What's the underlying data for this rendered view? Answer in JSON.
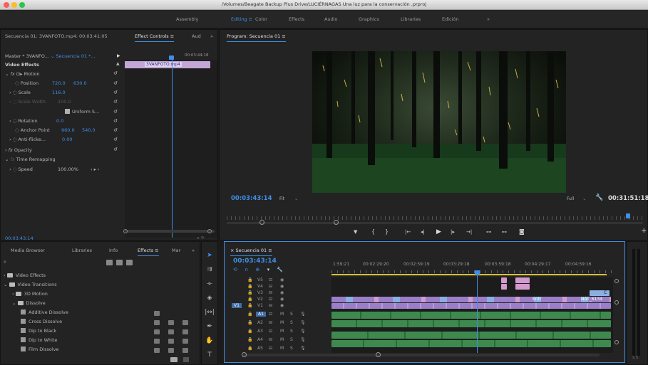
{
  "window": {
    "title": "/Volumes/Beagate Backup Plus Drive/LUCIÉRNAGAS Una luz para la conservación .prproj"
  },
  "workspaces": [
    {
      "label": "Assembly",
      "active": false
    },
    {
      "label": "Editing",
      "active": true
    },
    {
      "label": "Color",
      "active": false
    },
    {
      "label": "Effects",
      "active": false
    },
    {
      "label": "Audio",
      "active": false
    },
    {
      "label": "Graphics",
      "active": false
    },
    {
      "label": "Libraries",
      "active": false
    },
    {
      "label": "Edición",
      "active": false
    },
    {
      "label": "»",
      "active": false
    }
  ],
  "left_panel": {
    "tabs": [
      "Secuencia 01: 3VANFOTO.mp4: 00:03:41:05",
      "Effect Controls",
      "Aud",
      "»"
    ],
    "master_label": "Master * 3VANFO...",
    "sequence_label": "Secuencia 01 *...",
    "header_timecode": "00:03:44:18",
    "clip_name": "3VANFOTO.mp4",
    "video_effects": "Video Effects",
    "motion": "Motion",
    "position": {
      "label": "Position",
      "x": "720.0",
      "y": "630.0"
    },
    "scale": {
      "label": "Scale",
      "value": "116.0"
    },
    "scale_width": {
      "label": "Scale Width",
      "value": "100.0"
    },
    "uniform": "Uniform S...",
    "rotation": {
      "label": "Rotation",
      "value": "0.0"
    },
    "anchor": {
      "label": "Anchor Point",
      "x": "960.0",
      "y": "540.0"
    },
    "anti_flicker": {
      "label": "Anti-flicke...",
      "value": "0.00"
    },
    "opacity": "Opacity",
    "time_remap": "Time Remapping",
    "speed": {
      "label": "Speed",
      "value": "100.00%"
    },
    "bottom_timecode": "00:03:43:14"
  },
  "program": {
    "tab": "Program: Secuencia 01",
    "timecode": "00:03:43:14",
    "fit": "Fit",
    "quality": "Full",
    "duration": "00:31:51:18"
  },
  "effects_panel": {
    "tabs": [
      "Media Browser",
      "Libraries",
      "Info",
      "Effects",
      "Mar",
      "»"
    ],
    "search_placeholder": "",
    "items": [
      {
        "label": "Video Effects",
        "level": 0,
        "type": "folder"
      },
      {
        "label": "Video Transitions",
        "level": 0,
        "type": "folder"
      },
      {
        "label": "3D Motion",
        "level": 1,
        "type": "folder"
      },
      {
        "label": "Dissolve",
        "level": 1,
        "type": "folder"
      },
      {
        "label": "Additive Dissolve",
        "level": 2,
        "type": "item"
      },
      {
        "label": "Cross Dissolve",
        "level": 2,
        "type": "item"
      },
      {
        "label": "Dip to Black",
        "level": 2,
        "type": "item"
      },
      {
        "label": "Dip to White",
        "level": 2,
        "type": "item"
      },
      {
        "label": "Film Dissolve",
        "level": 2,
        "type": "item"
      }
    ]
  },
  "timeline": {
    "tab": "Secuencia 01",
    "timecode": "00:03:43:14",
    "ruler": [
      "1:59:21",
      "00:02:29:20",
      "00:02:59:19",
      "00:03:29:18",
      "00:03:59:18",
      "00:04:29:17",
      "00:04:59:16"
    ],
    "video_tracks": [
      "V5",
      "V4",
      "V3",
      "V2",
      "V1"
    ],
    "audio_tracks": [
      "A1",
      "A2",
      "A3",
      "A4",
      "A5"
    ],
    "source_patch": "V1",
    "audio_patch": "A1",
    "clip_labels": {
      "entr": "Entr",
      "nat": "NAT_6134",
      "c": "C"
    }
  },
  "colors": {
    "accent": "#3f8fe8",
    "clip_purple": "#9a7fc8",
    "clip_pink": "#d49ad0",
    "clip_green": "#3e8a4e",
    "clip_lightblue": "#8ab0e0"
  }
}
